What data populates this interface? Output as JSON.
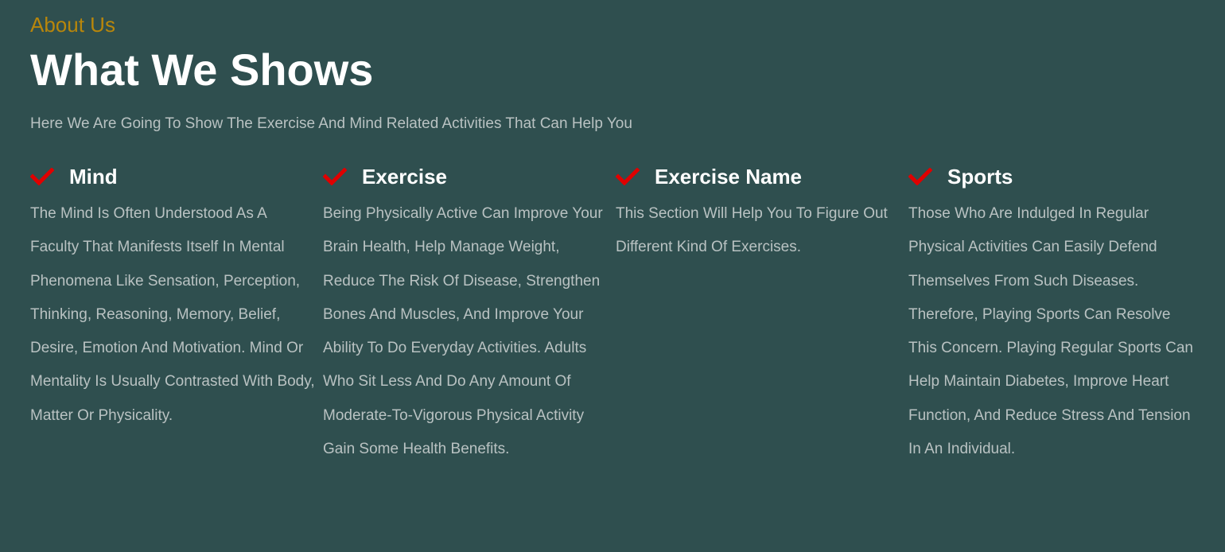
{
  "header": {
    "eyebrow": "About Us",
    "title": "What We Shows",
    "subtitle": "Here We Are Going To Show The Exercise And Mind Related Activities That Can Help You"
  },
  "features": [
    {
      "icon": "check-icon",
      "title": "Mind",
      "text": "The Mind Is Often Understood As A Faculty That Manifests Itself In Mental Phenomena Like Sensation, Perception, Thinking, Reasoning, Memory, Belief, Desire, Emotion And Motivation. Mind Or Mentality Is Usually Contrasted With Body, Matter Or Physicality."
    },
    {
      "icon": "check-icon",
      "title": "Exercise",
      "text": "Being Physically Active Can Improve Your Brain Health, Help Manage Weight, Reduce The Risk Of Disease, Strengthen Bones And Muscles, And Improve Your Ability To Do Everyday Activities. Adults Who Sit Less And Do Any Amount Of Moderate-To-Vigorous Physical Activity Gain Some Health Benefits."
    },
    {
      "icon": "check-icon",
      "title": "Exercise Name",
      "text": "This Section Will Help You To Figure Out Different Kind Of Exercises."
    },
    {
      "icon": "check-icon",
      "title": "Sports",
      "text": "Those Who Are Indulged In Regular Physical Activities Can Easily Defend Themselves From Such Diseases. Therefore, Playing Sports Can Resolve This Concern. Playing Regular Sports Can Help Maintain Diabetes, Improve Heart Function, And Reduce Stress And Tension In An Individual."
    }
  ],
  "colors": {
    "background": "#2f4f4f",
    "eyebrow": "#b8860b",
    "check": "#e00000",
    "body_text": "#b9c2c2"
  }
}
